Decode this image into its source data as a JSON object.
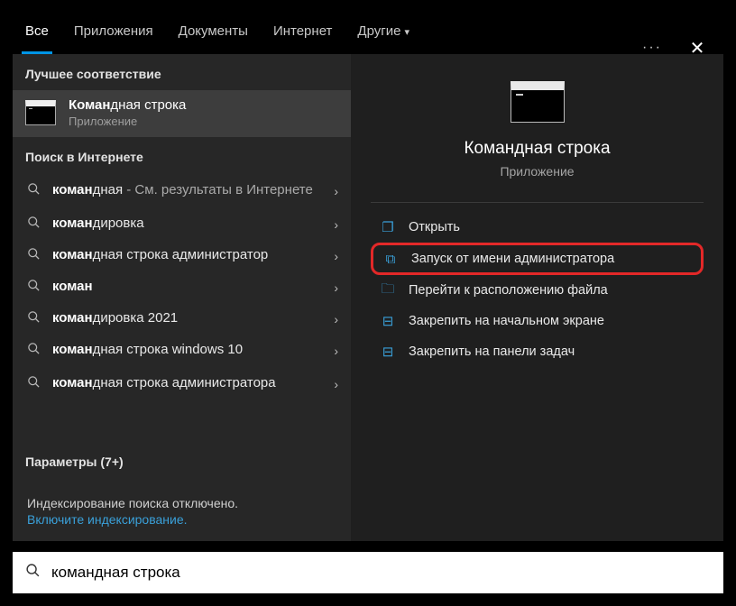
{
  "tabs": {
    "all": "Все",
    "apps": "Приложения",
    "docs": "Документы",
    "web": "Интернет",
    "more": "Другие"
  },
  "sections": {
    "best": "Лучшее соответствие",
    "web": "Поиск в Интернете",
    "settings": "Параметры (7+)"
  },
  "best_match": {
    "pre": "Коман",
    "post": "дная строка",
    "subtitle": "Приложение"
  },
  "web_results": [
    {
      "pre": "коман",
      "post": "дная",
      "after": " - См. результаты в Интернете",
      "twoline": true
    },
    {
      "pre": "коман",
      "post": "дировка"
    },
    {
      "pre": "коман",
      "post": "дная строка администратор"
    },
    {
      "pre": "коман",
      "post": ""
    },
    {
      "pre": "коман",
      "post": "дировка 2021"
    },
    {
      "pre": "коман",
      "post": "дная строка windows 10"
    },
    {
      "pre": "коман",
      "post": "дная строка администратора",
      "twoline": true
    }
  ],
  "indexing": {
    "off": "Индексирование поиска отключено.",
    "enable": "Включите индексирование."
  },
  "detail": {
    "title": "Командная строка",
    "subtitle": "Приложение"
  },
  "actions": {
    "open": "Открыть",
    "admin": "Запуск от имени администратора",
    "location": "Перейти к расположению файла",
    "pin_start": "Закрепить на начальном экране",
    "pin_task": "Закрепить на панели задач"
  },
  "search": {
    "value": "командная строка"
  }
}
